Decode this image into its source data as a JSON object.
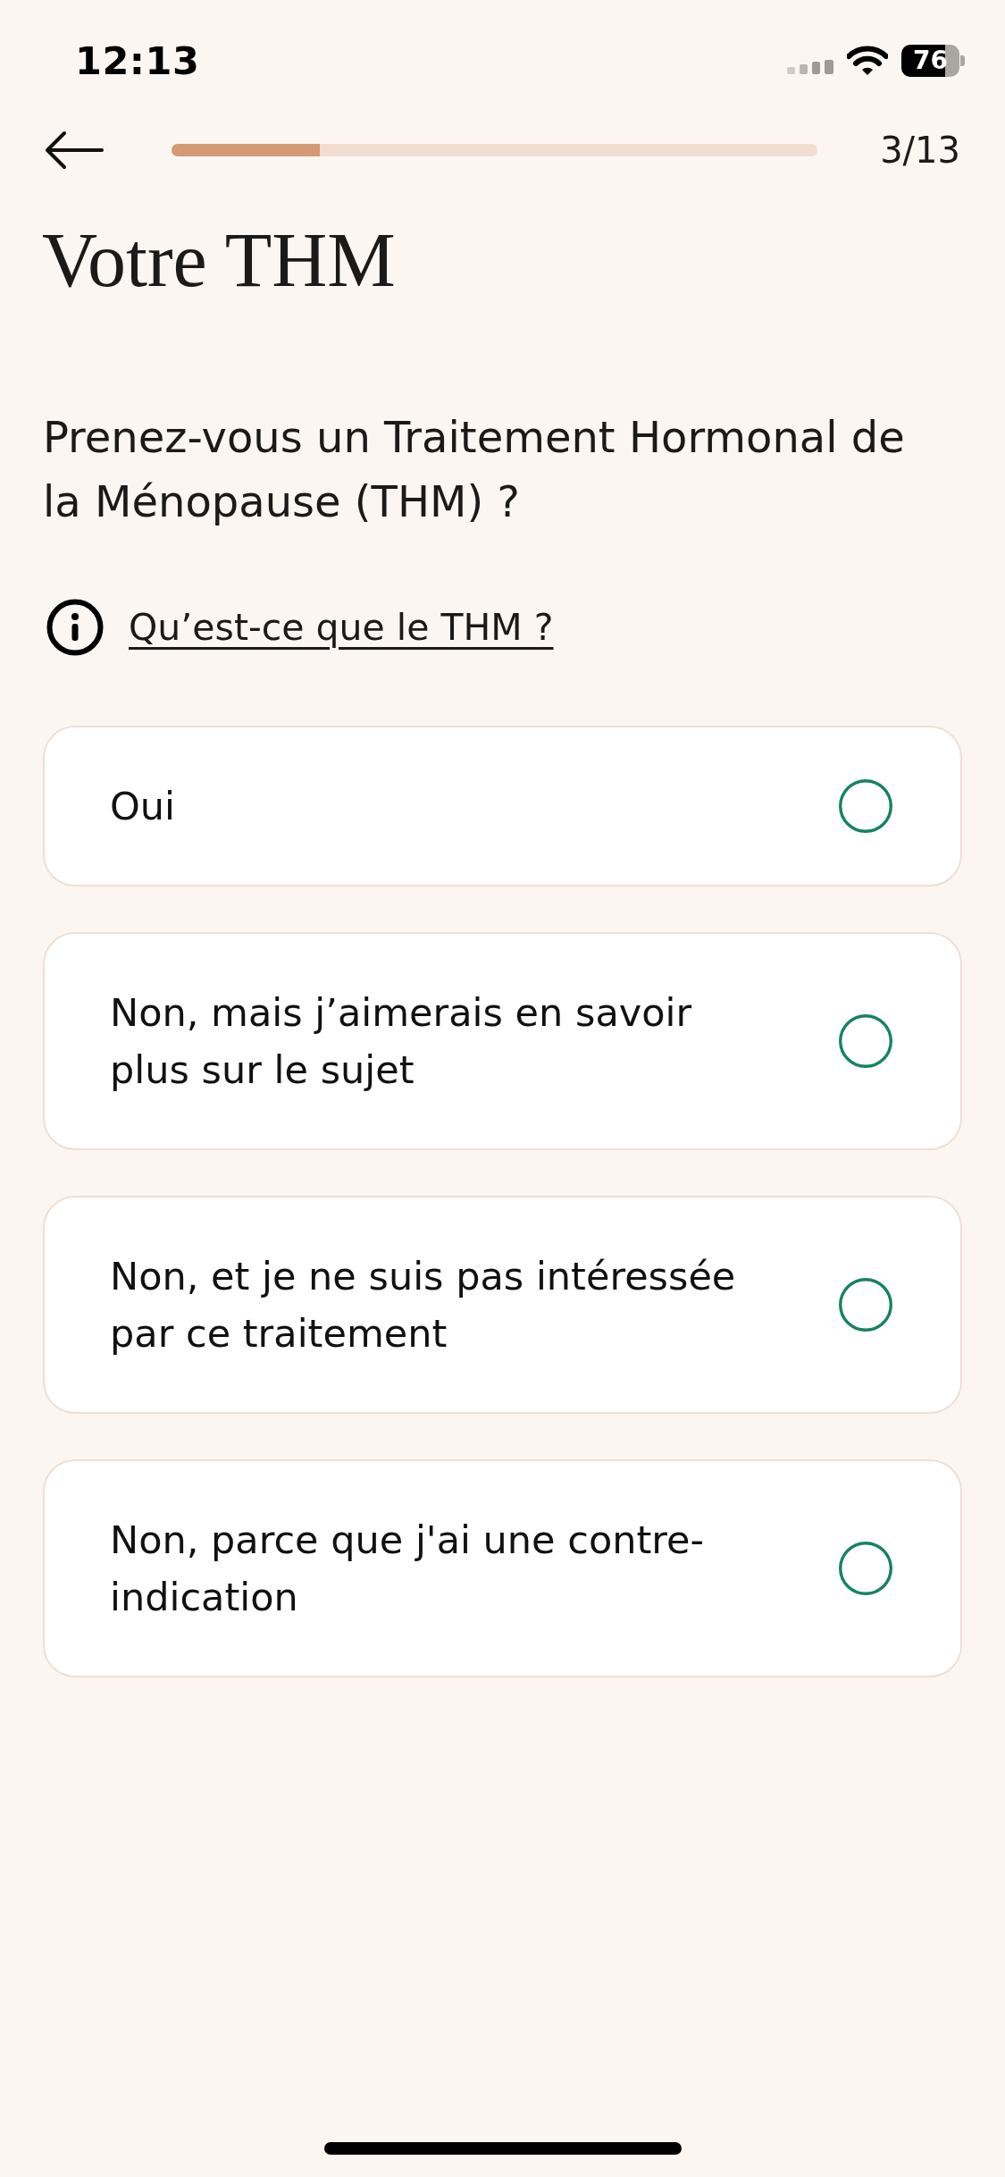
{
  "status_bar": {
    "time": "12:13",
    "battery": "76"
  },
  "header": {
    "progress": {
      "level": 0.23
    },
    "step": "3/13"
  },
  "title": "Votre THM",
  "question": "Prenez-vous un Traitement Hormonal de la Ménopause (THM) ?",
  "info_link": "Qu’est-ce que le THM ?",
  "options": [
    {
      "label": "Oui",
      "selected": false
    },
    {
      "label": "Non, mais j’aimerais en savoir plus sur le sujet",
      "selected": false
    },
    {
      "label": "Non, et je ne suis pas intéressée par ce traitement",
      "selected": false
    },
    {
      "label": "Non, parce que j'ai une contre-indication",
      "selected": false
    }
  ]
}
